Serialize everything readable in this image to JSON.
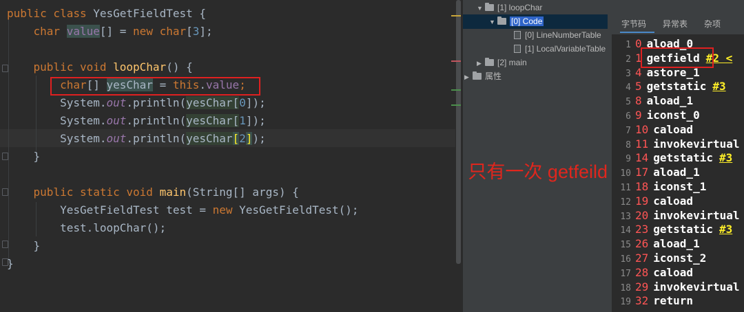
{
  "editor": {
    "lines": [
      [
        {
          "t": "public class ",
          "c": "kw"
        },
        {
          "t": "YesGetFieldTest {",
          "c": ""
        }
      ],
      [
        {
          "t": "    ",
          "c": ""
        },
        {
          "t": "char ",
          "c": "kw"
        },
        {
          "t": "value",
          "c": "fld hl-var"
        },
        {
          "t": "[] = ",
          "c": ""
        },
        {
          "t": "new char",
          "c": "kw"
        },
        {
          "t": "[",
          "c": ""
        },
        {
          "t": "3",
          "c": "num"
        },
        {
          "t": "];",
          "c": ""
        }
      ],
      [],
      [
        {
          "t": "    ",
          "c": ""
        },
        {
          "t": "public void ",
          "c": "kw"
        },
        {
          "t": "loopChar",
          "c": "fn"
        },
        {
          "t": "() {",
          "c": ""
        }
      ],
      [
        {
          "t": "        ",
          "c": ""
        },
        {
          "t": "char",
          "c": "kw"
        },
        {
          "t": "[] ",
          "c": ""
        },
        {
          "t": "yesChar",
          "c": "hl-var"
        },
        {
          "t": " = ",
          "c": ""
        },
        {
          "t": "this",
          "c": "kw"
        },
        {
          "t": ".",
          "c": ""
        },
        {
          "t": "value",
          "c": "fld"
        },
        {
          "t": ";",
          "c": "kw"
        }
      ],
      [
        {
          "t": "        System.",
          "c": ""
        },
        {
          "t": "out",
          "c": "stat"
        },
        {
          "t": ".println(",
          "c": ""
        },
        {
          "t": "yesChar",
          "c": "hl-val"
        },
        {
          "t": "[",
          "c": "hl-val"
        },
        {
          "t": "0",
          "c": "num"
        },
        {
          "t": "]);",
          "c": ""
        }
      ],
      [
        {
          "t": "        System.",
          "c": ""
        },
        {
          "t": "out",
          "c": "stat"
        },
        {
          "t": ".println(",
          "c": ""
        },
        {
          "t": "yesChar",
          "c": "hl-val"
        },
        {
          "t": "[",
          "c": "hl-val"
        },
        {
          "t": "1",
          "c": "num"
        },
        {
          "t": "]);",
          "c": ""
        }
      ],
      [
        {
          "t": "        System.",
          "c": ""
        },
        {
          "t": "out",
          "c": "stat"
        },
        {
          "t": ".println(",
          "c": ""
        },
        {
          "t": "yesChar",
          "c": "hl-val"
        },
        {
          "t": "[",
          "c": "hl-brk"
        },
        {
          "t": "2",
          "c": "num"
        },
        {
          "t": "]",
          "c": "hl-brk"
        },
        {
          "t": ");",
          "c": ""
        }
      ],
      [
        {
          "t": "    }",
          "c": ""
        }
      ],
      [],
      [
        {
          "t": "    ",
          "c": ""
        },
        {
          "t": "public static void ",
          "c": "kw"
        },
        {
          "t": "main",
          "c": "fn"
        },
        {
          "t": "(String[] args) {",
          "c": ""
        }
      ],
      [
        {
          "t": "        YesGetFieldTest test = ",
          "c": ""
        },
        {
          "t": "new ",
          "c": "kw"
        },
        {
          "t": "YesGetFieldTest();",
          "c": ""
        }
      ],
      [
        {
          "t": "        test.loopChar();",
          "c": ""
        }
      ],
      [
        {
          "t": "    }",
          "c": ""
        }
      ],
      [
        {
          "t": "}",
          "c": ""
        }
      ]
    ]
  },
  "tree": {
    "loopchar_label": "[1] loopChar",
    "code_label": "[0] Code",
    "line_number_table_label": "[0] LineNumberTable",
    "local_variable_table_label": "[1] LocalVariableTable",
    "main_label": "[2] main",
    "attributes_label": "属性"
  },
  "annotation": {
    "text": "只有一次 getfeild"
  },
  "bytecode_tabs": {
    "bytecode": "字节码",
    "exceptions": "异常表",
    "misc": "杂项"
  },
  "bytecode": [
    {
      "ln": "1",
      "off": "0",
      "op": "aload_0",
      "ref": ""
    },
    {
      "ln": "2",
      "off": "1",
      "op": "getfield",
      "ref": "#2 <"
    },
    {
      "ln": "3",
      "off": "4",
      "op": "astore_1",
      "ref": ""
    },
    {
      "ln": "4",
      "off": "5",
      "op": "getstatic",
      "ref": "#3"
    },
    {
      "ln": "5",
      "off": "8",
      "op": "aload_1",
      "ref": ""
    },
    {
      "ln": "6",
      "off": "9",
      "op": "iconst_0",
      "ref": ""
    },
    {
      "ln": "7",
      "off": "10",
      "op": "caload",
      "ref": ""
    },
    {
      "ln": "8",
      "off": "11",
      "op": "invokevirtual",
      "ref": ""
    },
    {
      "ln": "9",
      "off": "14",
      "op": "getstatic",
      "ref": "#3"
    },
    {
      "ln": "10",
      "off": "17",
      "op": "aload_1",
      "ref": ""
    },
    {
      "ln": "11",
      "off": "18",
      "op": "iconst_1",
      "ref": ""
    },
    {
      "ln": "12",
      "off": "19",
      "op": "caload",
      "ref": ""
    },
    {
      "ln": "13",
      "off": "20",
      "op": "invokevirtual",
      "ref": ""
    },
    {
      "ln": "14",
      "off": "23",
      "op": "getstatic",
      "ref": "#3"
    },
    {
      "ln": "15",
      "off": "26",
      "op": "aload_1",
      "ref": ""
    },
    {
      "ln": "16",
      "off": "27",
      "op": "iconst_2",
      "ref": ""
    },
    {
      "ln": "17",
      "off": "28",
      "op": "caload",
      "ref": ""
    },
    {
      "ln": "18",
      "off": "29",
      "op": "invokevirtual",
      "ref": ""
    },
    {
      "ln": "19",
      "off": "32",
      "op": "return",
      "ref": ""
    }
  ],
  "colors": {
    "editor_bg": "#2b2b2b",
    "keyword": "#cc7832",
    "method": "#ffc66d",
    "field": "#9876aa",
    "number": "#6897bb",
    "offset": "#ff5555",
    "reference": "#ffef28",
    "annotation": "#e0261d",
    "selection": "#2f65ca"
  }
}
